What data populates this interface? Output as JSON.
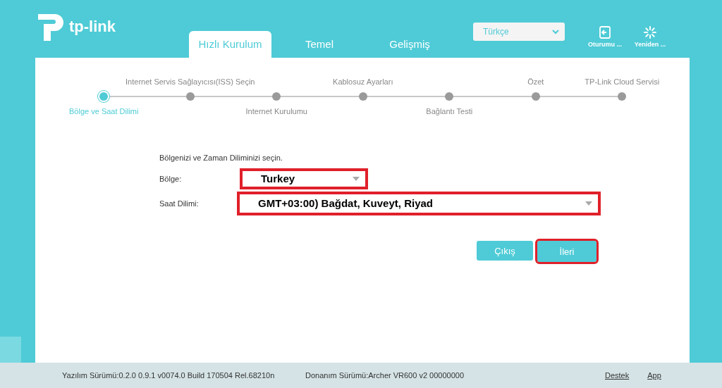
{
  "header": {
    "logo": "tp-link",
    "tabs": [
      {
        "label": "Hızlı Kurulum",
        "selected": true
      },
      {
        "label": "Temel",
        "selected": false
      },
      {
        "label": "Gelişmiş",
        "selected": false
      }
    ],
    "language": {
      "value": "Türkçe"
    },
    "actions": [
      {
        "kind": "logout",
        "label": "Oturumu ..."
      },
      {
        "kind": "reboot",
        "label": "Yeniden ..."
      }
    ]
  },
  "steps": [
    {
      "label": "Bölge ve Saat Dilimi",
      "kind": "below",
      "selected": true
    },
    {
      "label": "Internet Servis Sağlayıcısı(ISS) Seçin",
      "kind": "above",
      "selected": false
    },
    {
      "label": "Internet Kurulumu",
      "kind": "below",
      "selected": false
    },
    {
      "label": "Kablosuz Ayarları",
      "kind": "above",
      "selected": false
    },
    {
      "label": "Bağlantı Testi",
      "kind": "below",
      "selected": false
    },
    {
      "label": "Özet",
      "kind": "above",
      "selected": false
    },
    {
      "label": "TP-Link Cloud Servisi",
      "kind": "above",
      "selected": false
    }
  ],
  "form": {
    "intro": "Bölgenizi ve Zaman Diliminizi seçin.",
    "fields": [
      {
        "label": "Bölge:",
        "value": "Turkey",
        "kind": "short",
        "highlighted": true
      },
      {
        "label": "Saat Dilimi:",
        "value": "GMT+03:00) Bağdat, Kuveyt, Riyad",
        "kind": "long",
        "highlighted": true
      }
    ],
    "buttons": [
      {
        "label": "Çıkış",
        "highlighted": false
      },
      {
        "label": "İleri",
        "highlighted": true
      }
    ]
  },
  "footer": {
    "software": "Yazılım Sürümü:0.2.0 0.9.1 v0074.0 Build 170504 Rel.68210n",
    "hardware": "Donanım Sürümü:Archer VR600 v2 00000000",
    "links": [
      "Destek",
      "App"
    ]
  }
}
